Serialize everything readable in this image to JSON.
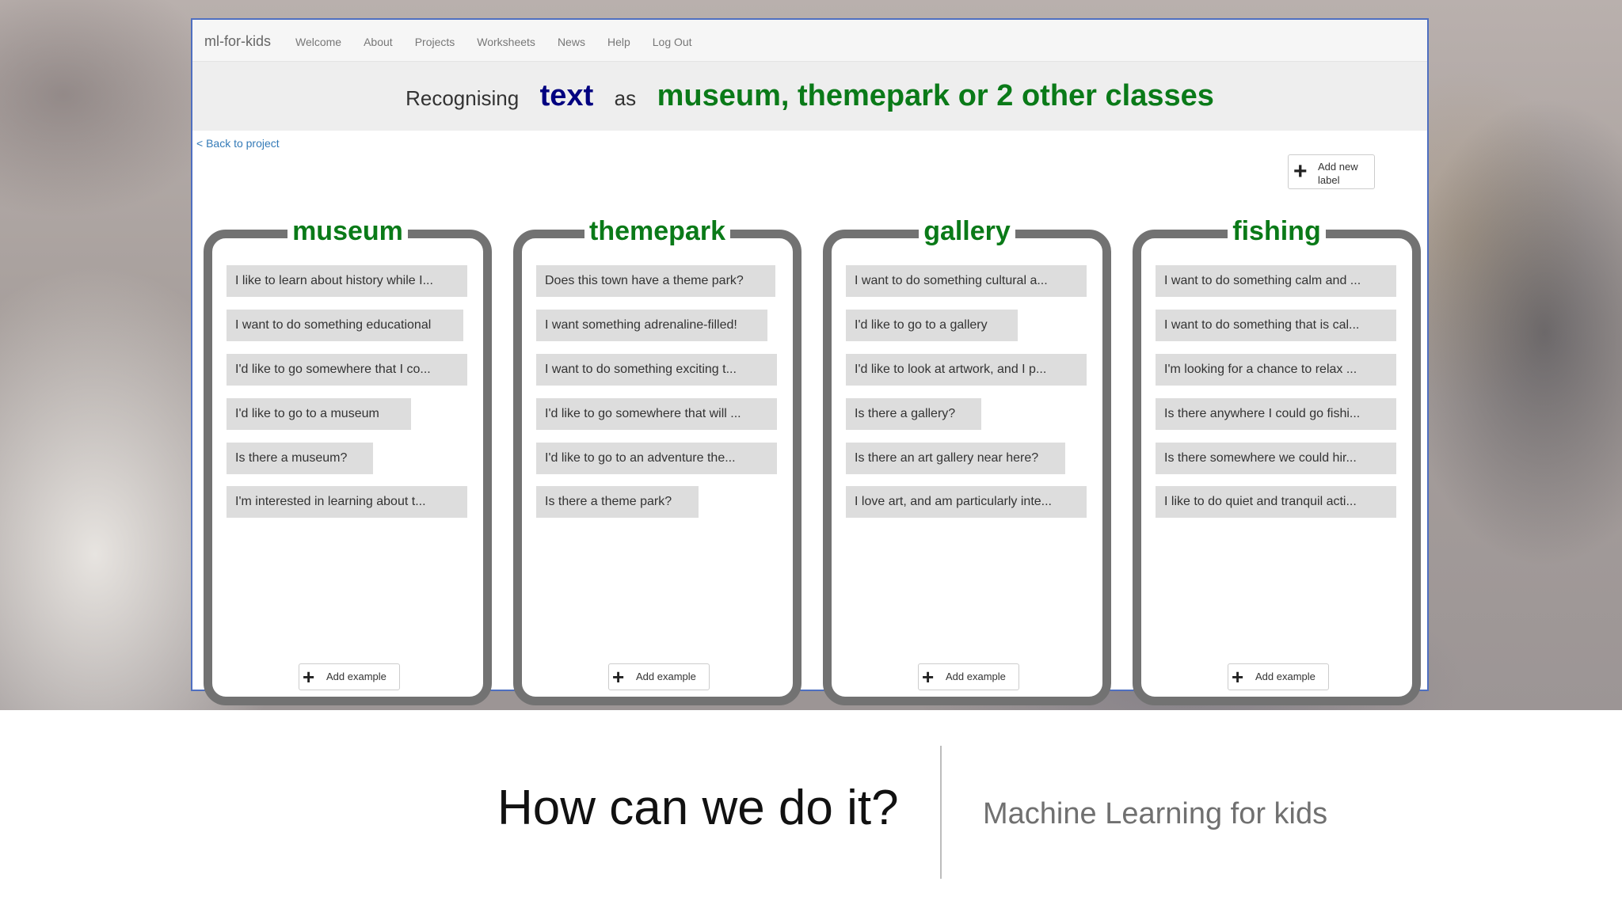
{
  "navbar": {
    "brand": "ml-for-kids",
    "links": [
      "Welcome",
      "About",
      "Projects",
      "Worksheets",
      "News",
      "Help",
      "Log Out"
    ]
  },
  "heading": {
    "prefix": "Recognising",
    "type": "text",
    "middle": "as",
    "classes": "museum, themepark or 2 other classes"
  },
  "back_link": "< Back to project",
  "add_label_button": "Add new label",
  "add_example_label": "Add example",
  "labels": [
    {
      "name": "museum",
      "examples": [
        "I like to learn about history while I...",
        "I want to do something educational",
        "I'd like to go somewhere that I co...",
        "I'd like to go to a museum",
        "Is there a museum?",
        "I'm interested in learning about t..."
      ]
    },
    {
      "name": "themepark",
      "examples": [
        "Does this town have a theme park?",
        "I want something adrenaline-filled!",
        "I want to do something exciting t...",
        "I'd like to go somewhere that will ...",
        "I'd like to go to an adventure the...",
        "Is there a theme park?"
      ]
    },
    {
      "name": "gallery",
      "examples": [
        "I want to do something cultural a...",
        "I'd like to go to a gallery",
        "I'd like to look at artwork, and I p...",
        "Is there a gallery?",
        "Is there an art gallery near here?",
        "I love art, and am particularly inte..."
      ]
    },
    {
      "name": "fishing",
      "examples": [
        "I want to do something calm and ...",
        "I want to do something that is cal...",
        "I'm looking for a chance to relax ...",
        "Is there anywhere I could go fishi...",
        "Is there somewhere we could hir...",
        "I like to do quiet and tranquil acti..."
      ]
    }
  ],
  "caption": {
    "question": "How can we do it?",
    "subtitle": "Machine Learning for kids"
  },
  "colors": {
    "label_green": "#0a7a18",
    "type_navy": "#000080",
    "link_blue": "#337ab7",
    "window_border": "#4f6fc0",
    "bucket_border": "#727272"
  },
  "icons": [
    "plus-icon"
  ]
}
